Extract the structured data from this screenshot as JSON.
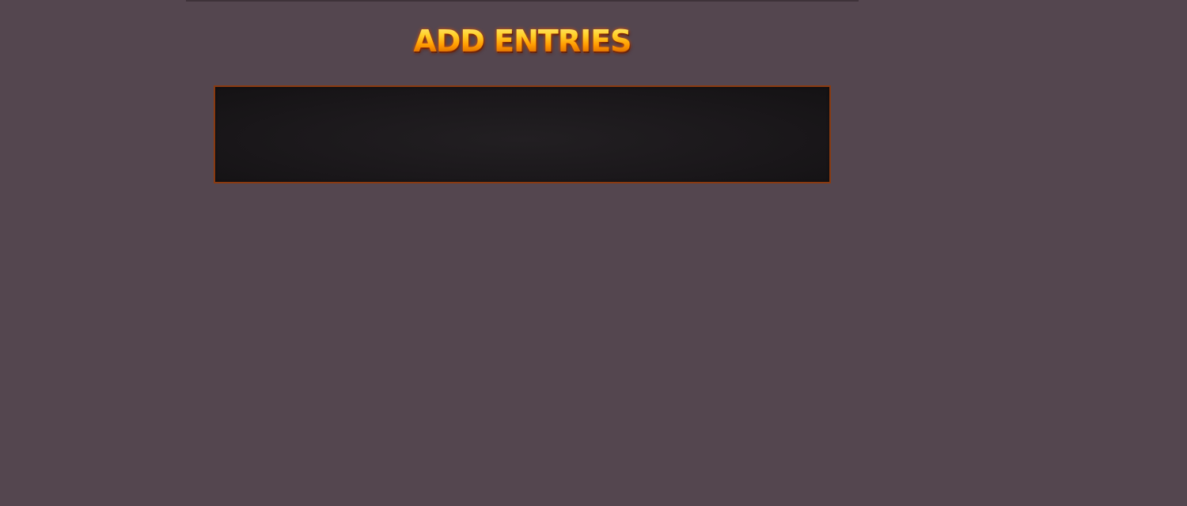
{
  "page": {
    "title": "ADD ENTRIES"
  },
  "colors": {
    "background": "#54464f",
    "title_gold": "#ffb000",
    "panel_fill": "#1b181b",
    "panel_border": "#8a3a10"
  }
}
